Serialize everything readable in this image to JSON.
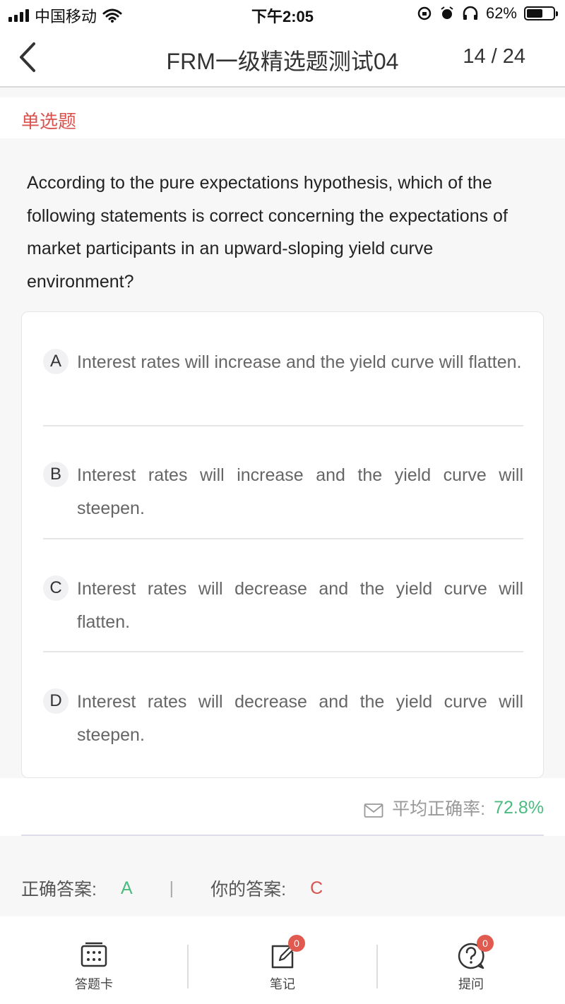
{
  "status_bar": {
    "carrier": "中国移动",
    "time": "下午2:05",
    "battery_percent": "62%",
    "battery_level": 0.62
  },
  "nav": {
    "title": "FRM一级精选题测试04",
    "progress": "14 / 24"
  },
  "question_type": "单选题",
  "question_text": "According to the pure expectations hypothesis, which of the following statements is correct concerning the expectations of market participants in an upward-sloping yield curve environment?",
  "options": [
    {
      "letter": "A",
      "text": "Interest rates will increase and the yield curve will flatten."
    },
    {
      "letter": "B",
      "text": "Interest rates will increase and the yield curve will steepen."
    },
    {
      "letter": "C",
      "text": "Interest rates will decrease and the yield curve will flatten."
    },
    {
      "letter": "D",
      "text": "Interest rates will decrease and the yield curve will steepen."
    }
  ],
  "stats": {
    "label": "平均正确率:",
    "value": "72.8%"
  },
  "answers": {
    "correct_label": "正确答案:",
    "correct_value": "A",
    "separator": "|",
    "yours_label": "你的答案:",
    "yours_value": "C"
  },
  "tabs": [
    {
      "label": "答题卡",
      "icon": "answer-sheet-icon"
    },
    {
      "label": "笔记",
      "icon": "note-icon",
      "badge": "0"
    },
    {
      "label": "提问",
      "icon": "question-icon",
      "badge": "0"
    }
  ],
  "colors": {
    "accent_red": "#d9534f",
    "accent_green": "#4cbb7f"
  }
}
